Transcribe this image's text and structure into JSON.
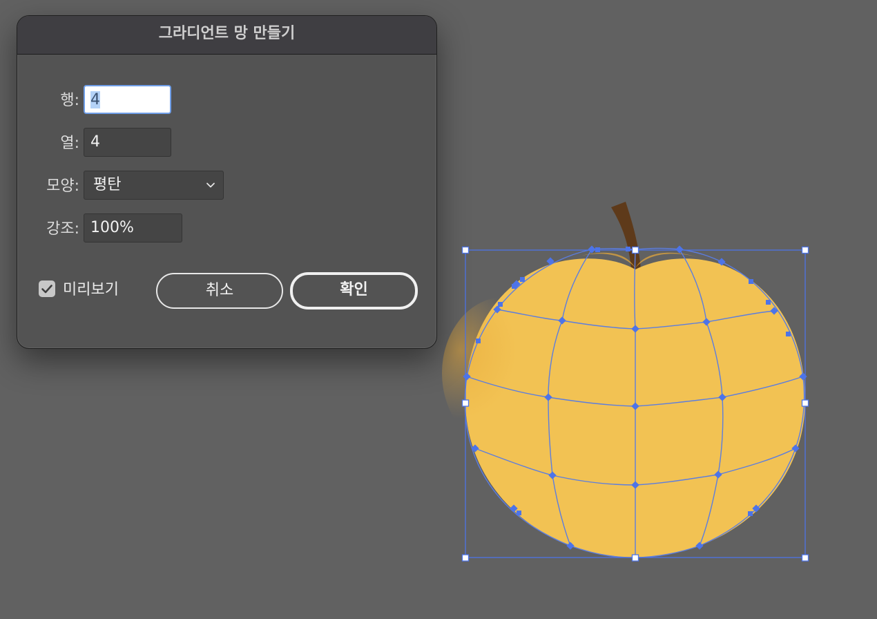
{
  "dialog": {
    "title": "그라디언트 망 만들기",
    "rows_label": "행:",
    "rows_value": "4",
    "columns_label": "열:",
    "columns_value": "4",
    "appearance_label": "모양:",
    "appearance_value": "평탄",
    "highlight_label": "강조:",
    "highlight_value": "100%",
    "preview_label": "미리보기",
    "preview_checked": true,
    "cancel_label": "취소",
    "ok_label": "확인"
  },
  "colors": {
    "canvas": "#616161",
    "dialog_bg": "#535353",
    "header_bg": "#3f3e42",
    "pear_fill": "#f2c253",
    "pear_shadow": "#e8aa3a",
    "stem": "#5e3a1a",
    "mesh_line": "#5b7de0",
    "selection": "#4d74e8"
  },
  "icons": {
    "dropdown": "chevron-down-icon",
    "checkbox": "checkmark-icon"
  }
}
